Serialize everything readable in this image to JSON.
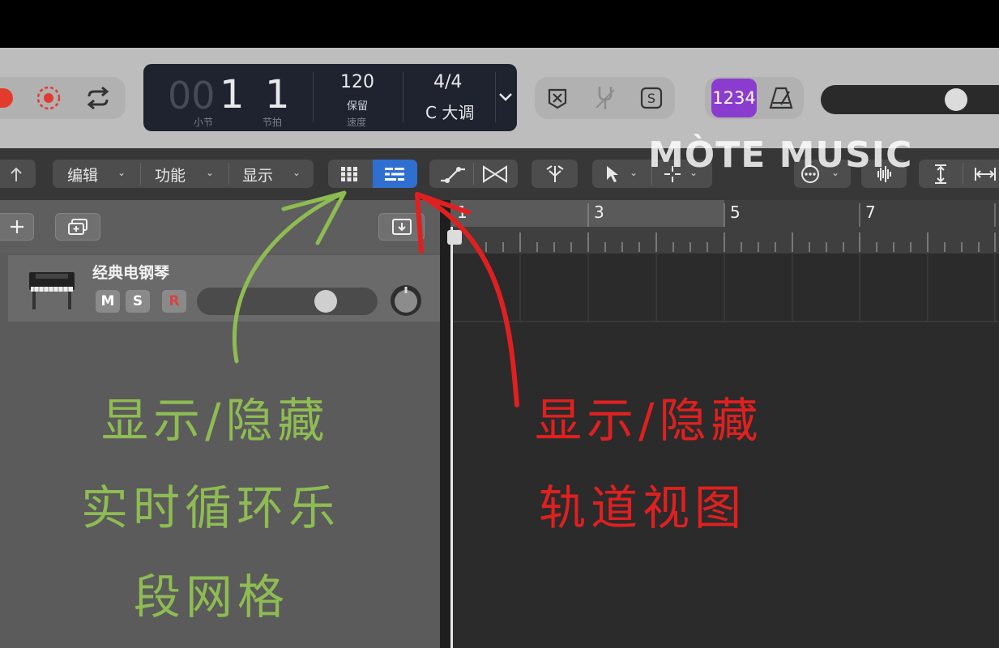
{
  "watermark": "MÒTE MUSIC",
  "transport": {
    "lcd": {
      "bar_dim": "00",
      "bar": "1",
      "beat": "1",
      "bar_label": "小节",
      "beat_label": "节拍",
      "tempo": "120",
      "tempo_mode": "保留",
      "tempo_label": "速度",
      "time_signature": "4/4",
      "key": "C 大调"
    },
    "count_in": "1234",
    "icons": [
      "record-icon",
      "capture-record-icon",
      "cycle-icon",
      "lcd-dropdown-icon",
      "replace-icon",
      "tuner-icon",
      "solo-icon",
      "count-in-icon",
      "metronome-icon",
      "master-volume-slider"
    ]
  },
  "toolbar": {
    "menus": [
      "编辑",
      "功能",
      "显示"
    ]
  },
  "ruler": {
    "bars": [
      "1",
      "3",
      "5",
      "7"
    ]
  },
  "track": {
    "name": "经典电钢琴",
    "mute": "M",
    "solo": "S",
    "record": "R",
    "volume_level": 0.7
  },
  "annotations": {
    "green": [
      "显示/隐藏",
      "实时循环乐",
      "段网格"
    ],
    "red": [
      "显示/隐藏",
      "轨道视图"
    ],
    "green_color": "#8ebc52",
    "red_color": "#e02020"
  },
  "colors": {
    "accent_blue": "#2f6fd0",
    "count_in_purple": "#8a3ccf",
    "record_red": "#e23b2e"
  }
}
